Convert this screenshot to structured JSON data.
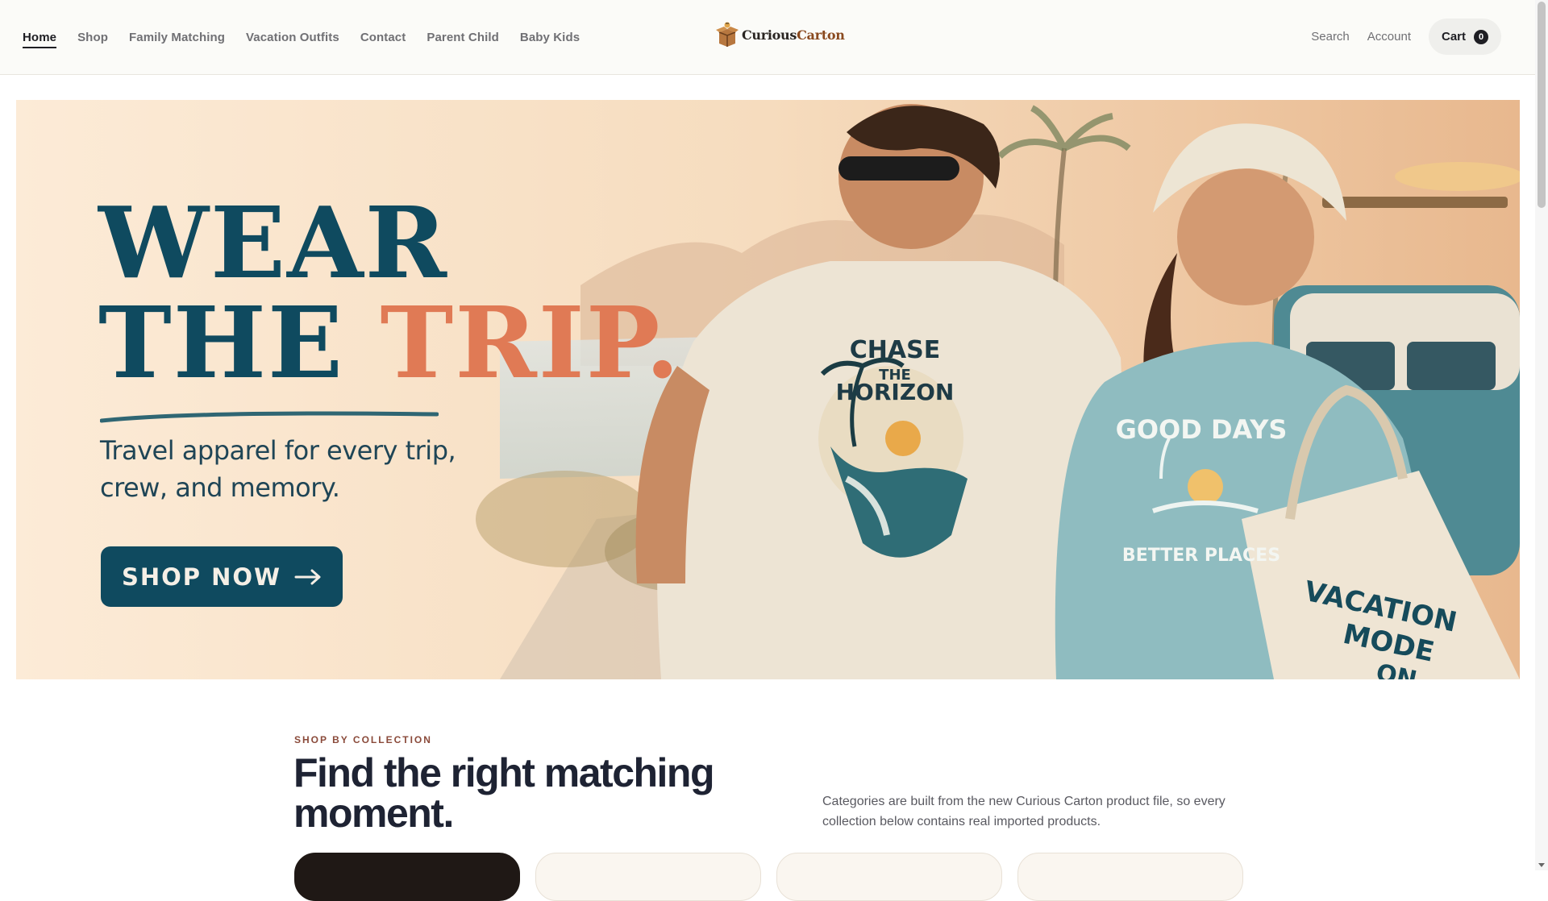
{
  "header": {
    "nav": [
      "Home",
      "Shop",
      "Family Matching",
      "Vacation Outfits",
      "Contact",
      "Parent Child",
      "Baby Kids"
    ],
    "active_nav": "Home",
    "logo_text_a": "Curious",
    "logo_text_b": "Carton",
    "search_label": "Search",
    "account_label": "Account",
    "cart_label": "Cart",
    "cart_count": "0"
  },
  "hero": {
    "headline_line1": "WEAR",
    "headline_line2a": "THE ",
    "headline_line2b": "TRIP.",
    "subtitle": "Travel apparel for every trip, crew, and memory.",
    "cta_label": "SHOP NOW",
    "shirt_text_1a": "CHASE",
    "shirt_text_1b": "THE",
    "shirt_text_1c": "HORIZON",
    "shirt_text_2a": "GOOD DAYS",
    "shirt_text_2b": "BETTER PLACES",
    "tote_text_a": "VACATION",
    "tote_text_b": "MODE",
    "tote_text_c": "ON"
  },
  "collection": {
    "eyebrow": "SHOP BY COLLECTION",
    "title": "Find the right matching moment.",
    "description": "Categories are built from the new Curious Carton product file, so every collection below contains real imported products."
  },
  "colors": {
    "brand_teal": "#0f4a5f",
    "accent_orange": "#e07a55",
    "text_dark": "#1e2333"
  }
}
